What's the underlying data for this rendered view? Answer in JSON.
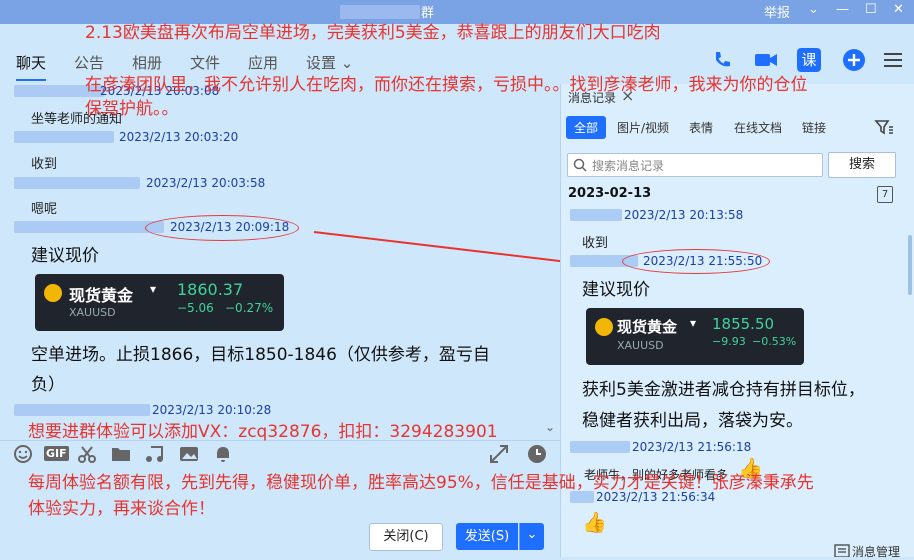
{
  "window": {
    "title_suffix": "群",
    "report_label": "举报",
    "minimize": "—",
    "maximize": "☐",
    "close": "✕"
  },
  "tabs": [
    {
      "label": "聊天"
    },
    {
      "label": "公告"
    },
    {
      "label": "相册"
    },
    {
      "label": "文件"
    },
    {
      "label": "应用"
    },
    {
      "label": "设置 ⌄"
    }
  ],
  "header_tools": {
    "course_label": "课"
  },
  "chat": {
    "messages": [
      {
        "time": "2023/2/13 20:03:08"
      },
      {
        "text": "坐等老师的通知",
        "time": "2023/2/13 20:03:20"
      },
      {
        "text": "收到",
        "time": "2023/2/13 20:03:58"
      },
      {
        "text": "嗯呢",
        "time": "2023/2/13 20:09:18"
      },
      {
        "text": "建议现价"
      },
      {
        "text": "空单进场。止损1866，目标1850-1846（仅供参考，盈亏自",
        "text2": "负）"
      },
      {
        "time": "2023/2/13 20:10:28"
      }
    ],
    "quote": {
      "name": "现货黄金",
      "caret": "▾",
      "symbol": "XAUUSD",
      "price": "1860.37",
      "change": "−5.06",
      "pct": "−0.27%"
    }
  },
  "history": {
    "title": "消息记录",
    "close": "×",
    "filters": [
      "全部",
      "图片/视频",
      "表情",
      "在线文档",
      "链接"
    ],
    "search_placeholder": "搜索消息记录",
    "search_button": "搜索",
    "date": "2023-02-13",
    "calendar_day": "7",
    "messages": [
      {
        "time": "2023/2/13 20:13:58"
      },
      {
        "text": "收到",
        "time": "2023/2/13 21:55:50"
      },
      {
        "text": "建议现价"
      },
      {
        "text": "获利5美金激进者减仓持有拼目标位，"
      },
      {
        "text": "稳健者获利出局，落袋为安。"
      },
      {
        "time": "2023/2/13 21:56:18"
      },
      {
        "text": "老师牛，别的好多老师看多"
      },
      {
        "time": "2023/2/13 21:56:34"
      }
    ],
    "quote": {
      "name": "现货黄金",
      "caret": "▾",
      "symbol": "XAUUSD",
      "price": "1855.50",
      "change": "−9.93",
      "pct": "−0.53%"
    },
    "manage_label": "消息管理"
  },
  "composer": {
    "close_button": "关闭(C)",
    "send_button": "发送(S)",
    "send_caret": "⌄",
    "gif_label": "GIF"
  },
  "overlay": {
    "line1": "2.13欧美盘再次布局空单进场，完美获利5美金，恭喜跟上的朋友们大口吃肉",
    "line2": "在彦溱团队里，我不允许别人在吃肉，而你还在摸索，亏损中。。找到彦溱老师，我来为你的仓位",
    "line3": "保驾护航。。",
    "line4": "想要进群体验可以添加VX：zcq32876，扣扣：3294283901",
    "line5": "每周体验名额有限，先到先得，稳健现价单，胜率高达95%，信任是基础，实力才是关键！张彦溱秉承先",
    "line6": "体验实力，再来谈合作！"
  },
  "colors": {
    "accent": "#1e6fff",
    "overlay_red": "#e8332f",
    "title_bar": "#7aa3e6",
    "chat_bg": "#cfe7fa"
  }
}
